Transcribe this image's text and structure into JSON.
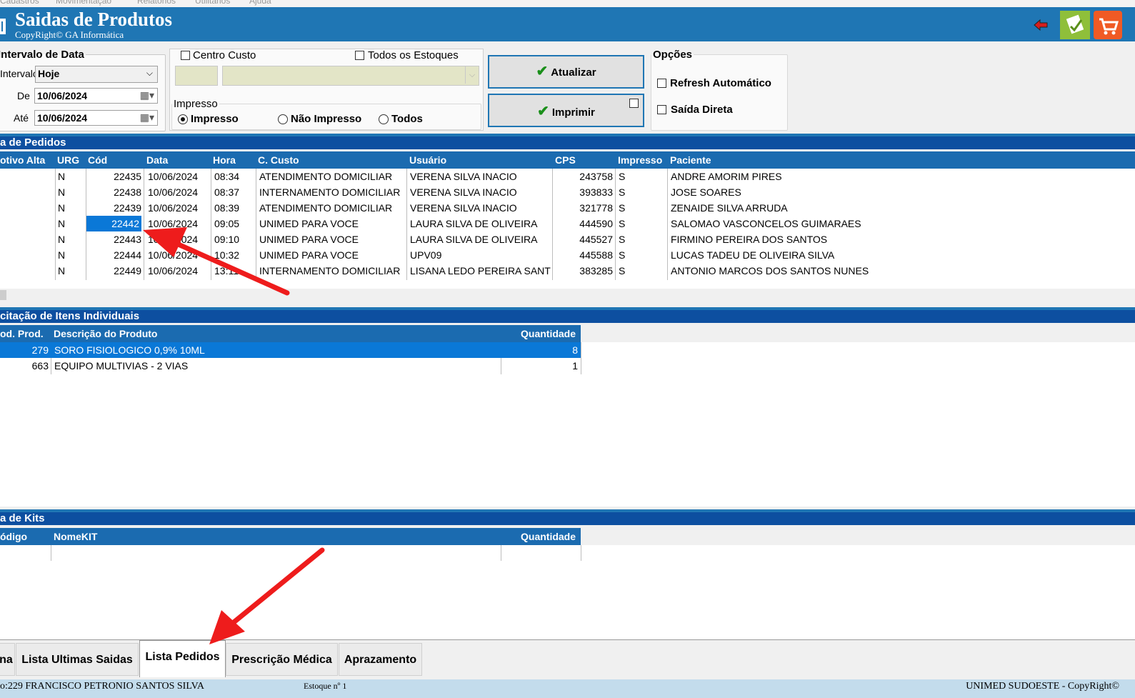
{
  "window": {
    "title": "Saidas de Produtos",
    "copyright": "CopyRight© GA Informática",
    "menu": [
      "Cadastros",
      "Movimentação",
      "Relatórios",
      "Utilitários",
      "Ajuda"
    ]
  },
  "header_icons": [
    "back-arrow-icon",
    "document-icon",
    "cart-icon"
  ],
  "date_interval": {
    "legend": "Intervalo de Data",
    "interval_label": "Intervalo",
    "interval_value": "Hoje",
    "from_label": "De",
    "from_value": "10/06/2024",
    "to_label": "Até",
    "to_value": "10/06/2024"
  },
  "cost_center": {
    "checkbox_label": "Centro Custo",
    "all_stock_label": "Todos os Estoques",
    "print_legend": "Impresso",
    "radio_printed": "Impresso",
    "radio_not_printed": "Não Impresso",
    "radio_all": "Todos"
  },
  "buttons": {
    "update": "Atualizar",
    "print": "Imprimir"
  },
  "options": {
    "legend": "Opções",
    "auto_refresh": "Refresh Automático",
    "direct_exit": "Saída Direta"
  },
  "orders": {
    "section_title": "a de Pedidos",
    "columns": [
      "otivo Alta",
      "URG",
      "Cód",
      "Data",
      "Hora",
      "C. Custo",
      "Usuário",
      "CPS",
      "Impresso",
      "Paciente"
    ],
    "rows": [
      {
        "urg": "N",
        "cod": "22435",
        "data": "10/06/2024",
        "hora": "08:34",
        "custo": "ATENDIMENTO DOMICILIAR",
        "usuario": "VERENA SILVA INACIO",
        "cps": "243758",
        "impresso": "S",
        "paciente": "ANDRE AMORIM PIRES"
      },
      {
        "urg": "N",
        "cod": "22438",
        "data": "10/06/2024",
        "hora": "08:37",
        "custo": "INTERNAMENTO DOMICILIAR",
        "usuario": "VERENA SILVA INACIO",
        "cps": "393833",
        "impresso": "S",
        "paciente": "JOSE SOARES"
      },
      {
        "urg": "N",
        "cod": "22439",
        "data": "10/06/2024",
        "hora": "08:39",
        "custo": "ATENDIMENTO DOMICILIAR",
        "usuario": "VERENA SILVA INACIO",
        "cps": "321778",
        "impresso": "S",
        "paciente": "ZENAIDE SILVA ARRUDA"
      },
      {
        "urg": "N",
        "cod": "22442",
        "data": "10/06/2024",
        "hora": "09:05",
        "custo": "UNIMED PARA VOCE",
        "usuario": "LAURA SILVA DE OLIVEIRA",
        "cps": "444590",
        "impresso": "S",
        "paciente": "SALOMAO VASCONCELOS GUIMARAES"
      },
      {
        "urg": "N",
        "cod": "22443",
        "data": "10/06/2024",
        "hora": "09:10",
        "custo": "UNIMED PARA VOCE",
        "usuario": "LAURA SILVA DE OLIVEIRA",
        "cps": "445527",
        "impresso": "S",
        "paciente": "FIRMINO PEREIRA DOS SANTOS"
      },
      {
        "urg": "N",
        "cod": "22444",
        "data": "10/06/2024",
        "hora": "10:32",
        "custo": "UNIMED PARA VOCE",
        "usuario": "UPV09",
        "cps": "445588",
        "impresso": "S",
        "paciente": "LUCAS TADEU DE OLIVEIRA SILVA"
      },
      {
        "urg": "N",
        "cod": "22449",
        "data": "10/06/2024",
        "hora": "13:11",
        "custo": "INTERNAMENTO DOMICILIAR",
        "usuario": "LISANA LEDO PEREIRA SANT",
        "cps": "383285",
        "impresso": "S",
        "paciente": "ANTONIO MARCOS DOS SANTOS NUNES"
      }
    ]
  },
  "items": {
    "section_title": "citação de Itens Individuais",
    "columns": [
      "od. Prod.",
      "Descrição do Produto",
      "Quantidade"
    ],
    "rows": [
      {
        "cod": "279",
        "desc": "SORO FISIOLOGICO 0,9% 10ML",
        "qtd": "8"
      },
      {
        "cod": "663",
        "desc": "EQUIPO MULTIVIAS - 2 VIAS",
        "qtd": "1"
      }
    ]
  },
  "kits": {
    "section_title": "a de Kits",
    "columns": [
      "ódigo",
      "NomeKIT",
      "Quantidade"
    ]
  },
  "tabs": [
    "na",
    "Lista Ultimas Saidas",
    "Lista Pedidos",
    "Prescrição Médica",
    "Aprazamento"
  ],
  "status_bar": {
    "user": "o:229 FRANCISCO PETRONIO SANTOS SILVA",
    "stock": "Estoque nº 1",
    "company": "UNIMED SUDOESTE - CopyRight©"
  },
  "colors": {
    "banner": "#1f76b4",
    "section": "#0d4fa0",
    "selected": "#0a78d7",
    "annotation": "#ee1c1c"
  }
}
